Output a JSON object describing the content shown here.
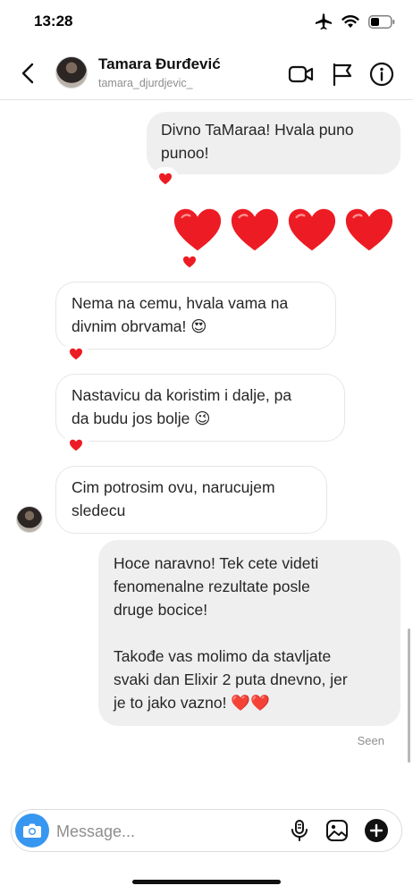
{
  "status_bar": {
    "time": "13:28",
    "icons": [
      "airplane-icon",
      "wifi-icon",
      "battery-icon"
    ]
  },
  "header": {
    "back_icon": "chevron-left-icon",
    "name": "Tamara Đurđević",
    "username": "tamara_djurdjevic_",
    "actions": [
      "video-call-icon",
      "flag-icon",
      "info-icon"
    ]
  },
  "messages": [
    {
      "from": "me",
      "lines": [
        "Divno TaMaraa! Hvala puno",
        "punoo!"
      ],
      "reaction": "❤️"
    },
    {
      "from": "me",
      "type": "emoji",
      "content": "❤️❤️❤️❤️",
      "reaction": "❤️"
    },
    {
      "from": "them",
      "lines": [
        "Nema na cemu, hvala vama na",
        "divnim obrvama! 😍"
      ],
      "reaction": "❤️"
    },
    {
      "from": "them",
      "lines": [
        "Nastavicu da koristim i dalje, pa",
        "da budu jos bolje 😉"
      ],
      "reaction": "❤️"
    },
    {
      "from": "them",
      "lines": [
        "Cim potrosim ovu, narucujem",
        "sledecu"
      ]
    },
    {
      "from": "me",
      "lines": [
        "Hoce naravno! Tek cete videti",
        "fenomenalne rezultate posle",
        "druge bocice!",
        "",
        "Takođe vas molimo da stavljate",
        "svaki dan Elixir 2 puta dnevno, jer",
        "je to jako vazno! ❤️❤️"
      ]
    }
  ],
  "seen_label": "Seen",
  "composer": {
    "placeholder": "Message...",
    "icons": [
      "camera-icon",
      "microphone-icon",
      "gallery-icon",
      "plus-icon"
    ]
  },
  "colors": {
    "accent": "#3797f0",
    "outgoing_bubble": "#efefef",
    "heart": "#ed1c24"
  }
}
